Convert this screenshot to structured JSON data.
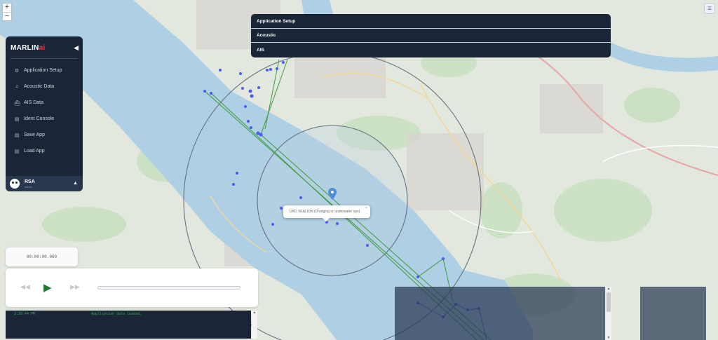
{
  "app": {
    "brand_main": "MARLIN",
    "brand_accent": "ai",
    "collapse_icon": "chevron-left-icon"
  },
  "map_controls": {
    "zoom_in": "+",
    "zoom_out": "−",
    "layers_icon": "layers-icon"
  },
  "sidebar": {
    "items": [
      {
        "label": "Application Setup",
        "icon": "gear-icon",
        "glyph": "⚙"
      },
      {
        "label": "Acoustic Data",
        "icon": "headphones-icon",
        "glyph": "♫"
      },
      {
        "label": "AIS Data",
        "icon": "ship-icon",
        "glyph": "⛴"
      },
      {
        "label": "Ident Console",
        "icon": "clipboard-icon",
        "glyph": "▤"
      },
      {
        "label": "Save App",
        "icon": "save-icon",
        "glyph": "▤"
      },
      {
        "label": "Load App",
        "icon": "file-icon",
        "glyph": "▤"
      }
    ],
    "user": {
      "name": "RSA",
      "subtitle": "admin",
      "caret": "▲"
    }
  },
  "accordion": {
    "items": [
      "Application Setup",
      "Acoustic",
      "AIS"
    ]
  },
  "map_popup": {
    "text": "UKD SEALION (Dredging or underwater ops)",
    "close": "×"
  },
  "timer": {
    "value": "00:00:00.000"
  },
  "player": {
    "prev_glyph": "◀◀",
    "play_glyph": "▶",
    "next_glyph": "▶▶",
    "progress": 0
  },
  "console": {
    "timestamp": "2:30:44 PM",
    "message": "Application data loaded."
  },
  "colors": {
    "sidebar_bg": "#1a2638",
    "track_green": "#3c9b3c",
    "vessel_blue": "#4a5cf0",
    "water": "#aacde3",
    "land": "#dfe7dc"
  }
}
